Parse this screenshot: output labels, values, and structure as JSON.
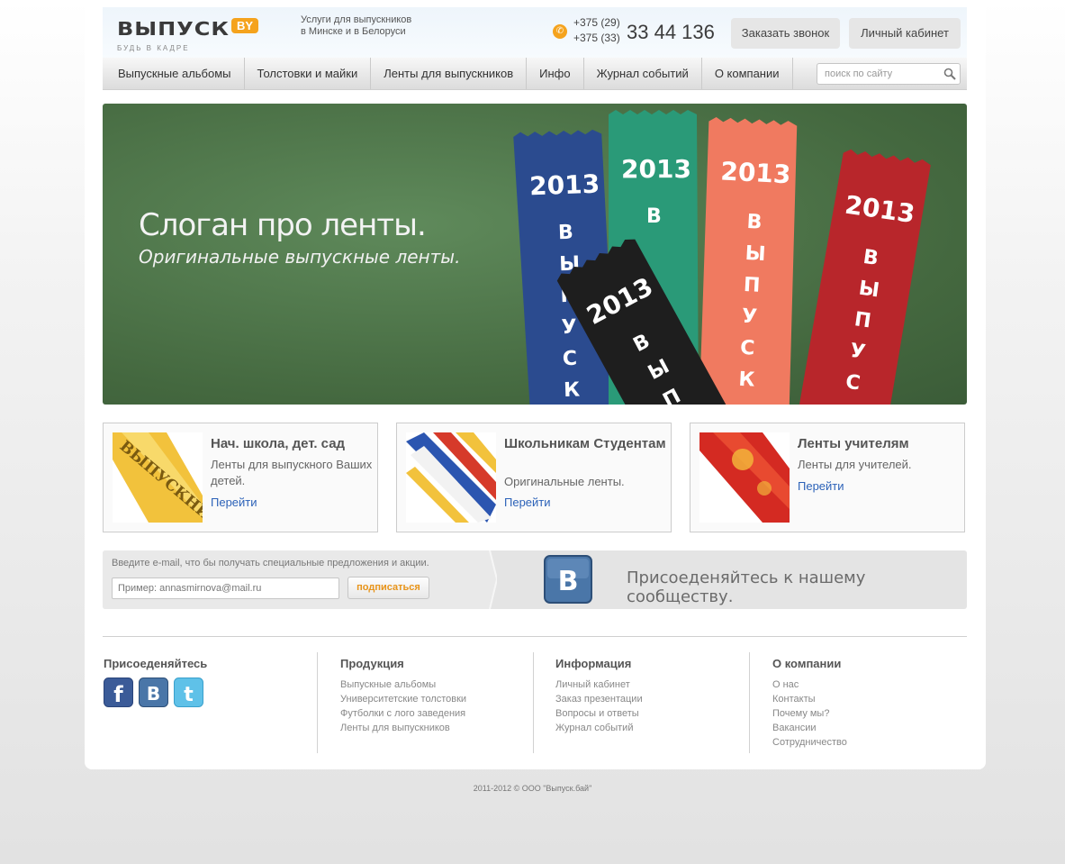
{
  "header": {
    "logo_text": "ВЫПУСК",
    "logo_badge": "BY",
    "logo_tagline": "БУДЬ В КАДРЕ",
    "tagline_line1": "Услуги для выпускников",
    "tagline_line2": "в Минске и в Белоруси",
    "phone_code1": "+375 (29)",
    "phone_code2": "+375 (33)",
    "phone_number": "33 44 136",
    "call_button": "Заказать звонок",
    "cabinet_button": "Личный кабинет"
  },
  "nav": {
    "items": [
      "Выпускные альбомы",
      "Толстовки и майки",
      "Ленты для выпускников",
      "Инфо",
      "Журнал событий",
      "О компании"
    ],
    "search_placeholder": "поиск по сайту"
  },
  "banner": {
    "slogan": "Слоган про ленты.",
    "subslogan": "Оригинальные выпускные ленты.",
    "ribbon_year": "2013"
  },
  "cards": [
    {
      "title": "Нач. школа, дет. сад",
      "desc": "Ленты для выпускного Ваших детей.",
      "link": "Перейти"
    },
    {
      "title": "Школьникам Студентам",
      "desc": "Оригинальные ленты.",
      "link": "Перейти"
    },
    {
      "title": "Ленты учителям",
      "desc": "Ленты для учителей.",
      "link": "Перейти"
    }
  ],
  "subscribe": {
    "label": "Введите e-mail, что бы получать специальные предложения и акции.",
    "placeholder": "Пример: annasmirnova@mail.ru",
    "button": "подписаться",
    "join_text": "Присоеденяйтесь к нашему сообществу."
  },
  "footer": {
    "col1_title": "Присоеденяйтесь",
    "col2_title": "Продукция",
    "col2_links": [
      "Выпускные альбомы",
      "Университетские толстовки",
      "Футболки с лого заведения",
      "Ленты для выпускников"
    ],
    "col3_title": "Информация",
    "col3_links": [
      "Личный кабинет",
      "Заказ презентации",
      "Вопросы и ответы",
      "Журнал событий"
    ],
    "col4_title": "О компании",
    "col4_links": [
      "О нас",
      "Контакты",
      "Почему мы?",
      "Вакансии",
      "Сотрудничество"
    ],
    "copyright": "2011-2012  ©  ООО \"Выпуск.бай\""
  },
  "colors": {
    "accent": "#f5a31d",
    "link": "#2c62b8",
    "banner_green": "#4f7749",
    "ribbon_blue": "#2b4b8f",
    "ribbon_green": "#2a9a78",
    "ribbon_salmon": "#f07a60",
    "ribbon_red": "#b8262b",
    "ribbon_black": "#1e1e1e"
  }
}
